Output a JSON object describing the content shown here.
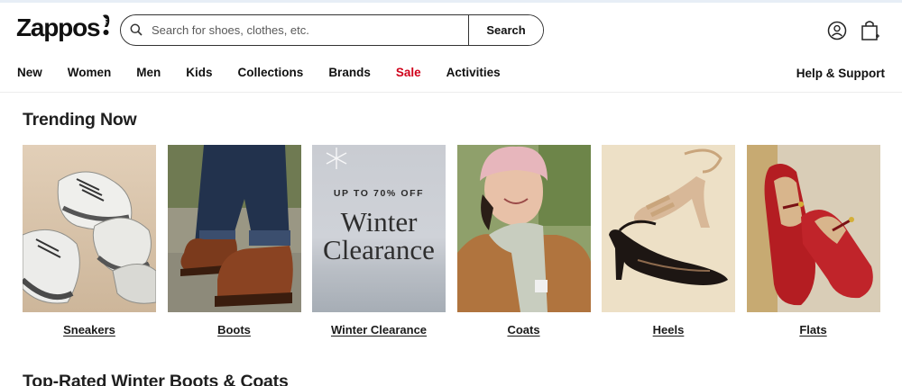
{
  "brand": {
    "logo_text": "Zappos"
  },
  "search": {
    "placeholder": "Search for shoes, clothes, etc.",
    "button_label": "Search"
  },
  "nav": {
    "items": [
      {
        "label": "New"
      },
      {
        "label": "Women"
      },
      {
        "label": "Men"
      },
      {
        "label": "Kids"
      },
      {
        "label": "Collections"
      },
      {
        "label": "Brands"
      },
      {
        "label": "Sale",
        "highlight": true
      },
      {
        "label": "Activities"
      }
    ],
    "help_label": "Help & Support"
  },
  "trending": {
    "title": "Trending Now",
    "cards": [
      {
        "label": "Sneakers"
      },
      {
        "label": "Boots"
      },
      {
        "label": "Winter Clearance",
        "image_sub": "UP TO 70% OFF",
        "image_line1": "Winter",
        "image_line2": "Clearance"
      },
      {
        "label": "Coats"
      },
      {
        "label": "Heels"
      },
      {
        "label": "Flats"
      }
    ]
  },
  "next_section": {
    "title": "Top-Rated Winter Boots & Coats"
  },
  "colors": {
    "sale": "#d0021b",
    "text": "#111111",
    "border": "#333333"
  }
}
